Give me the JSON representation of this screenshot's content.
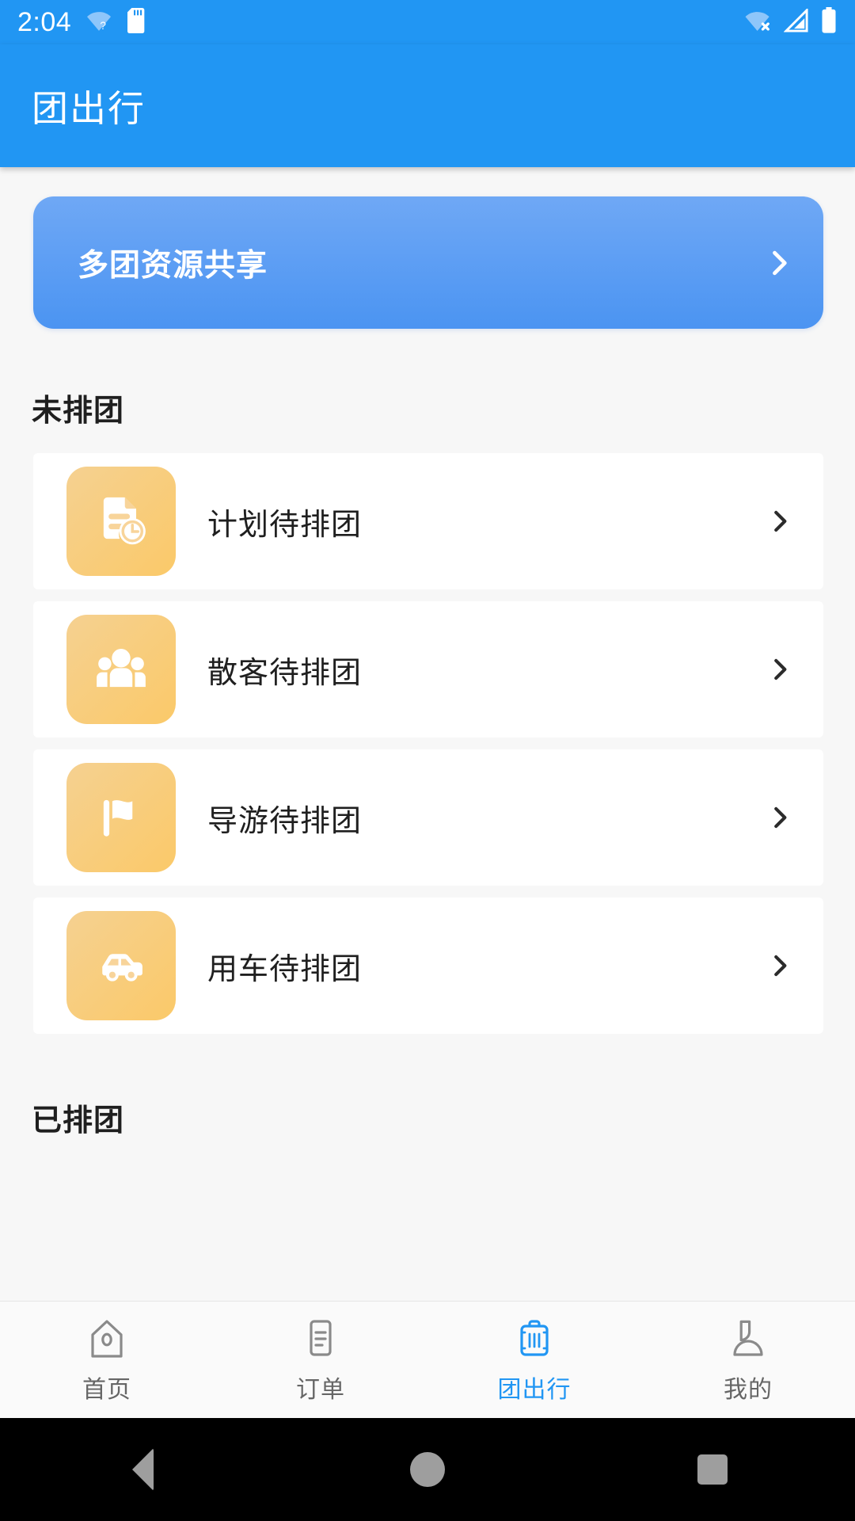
{
  "status_bar": {
    "time": "2:04",
    "icons_left": [
      "wifi-question-icon",
      "sd-card-icon"
    ],
    "icons_right": [
      "wifi-off-icon",
      "cellular-signal-icon",
      "battery-full-icon"
    ]
  },
  "app_bar": {
    "title": "团出行"
  },
  "banner": {
    "title": "多团资源共享",
    "chevron": "chevron-right-icon",
    "gradient_from": "#6fa8f5",
    "gradient_to": "#4b94f2"
  },
  "sections": [
    {
      "title": "未排团",
      "items": [
        {
          "label": "计划待排团",
          "icon": "document-clock-icon"
        },
        {
          "label": "散客待排团",
          "icon": "people-group-icon"
        },
        {
          "label": "导游待排团",
          "icon": "flag-icon"
        },
        {
          "label": "用车待排团",
          "icon": "car-icon"
        }
      ]
    },
    {
      "title": "已排团",
      "items": []
    }
  ],
  "tab_bar": {
    "active_color": "#2196f3",
    "inactive_color": "#666666",
    "tabs": [
      {
        "label": "首页",
        "icon": "home-icon",
        "active": false
      },
      {
        "label": "订单",
        "icon": "order-list-icon",
        "active": false
      },
      {
        "label": "团出行",
        "icon": "suitcase-icon",
        "active": true
      },
      {
        "label": "我的",
        "icon": "person-icon",
        "active": false
      }
    ]
  },
  "system_nav": {
    "buttons": [
      "back-button",
      "home-button",
      "recents-button"
    ]
  },
  "theme": {
    "primary": "#2196f3",
    "page_background": "#f7f7f7",
    "card_background": "#ffffff",
    "icon_tile_from": "#f5d191",
    "icon_tile_to": "#fbc969",
    "text_primary": "#1f1f1f"
  }
}
